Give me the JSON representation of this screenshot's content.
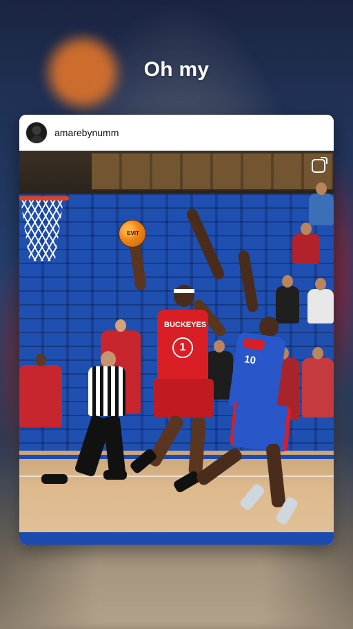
{
  "caption": "Oh my",
  "post": {
    "username": "amarebynumm",
    "avatar_icon": "profile-avatar",
    "media_icon": "multiple-media-icon"
  },
  "photo": {
    "red_jersey_team": "BUCKEYES",
    "red_jersey_number": "1",
    "blue_jersey_number": "10",
    "ball_label": "EVIT",
    "colors": {
      "red_team": "#d91f25",
      "blue_team": "#2956c8",
      "court_line": "#1c4bb0",
      "floor": "#dcb68a"
    }
  }
}
